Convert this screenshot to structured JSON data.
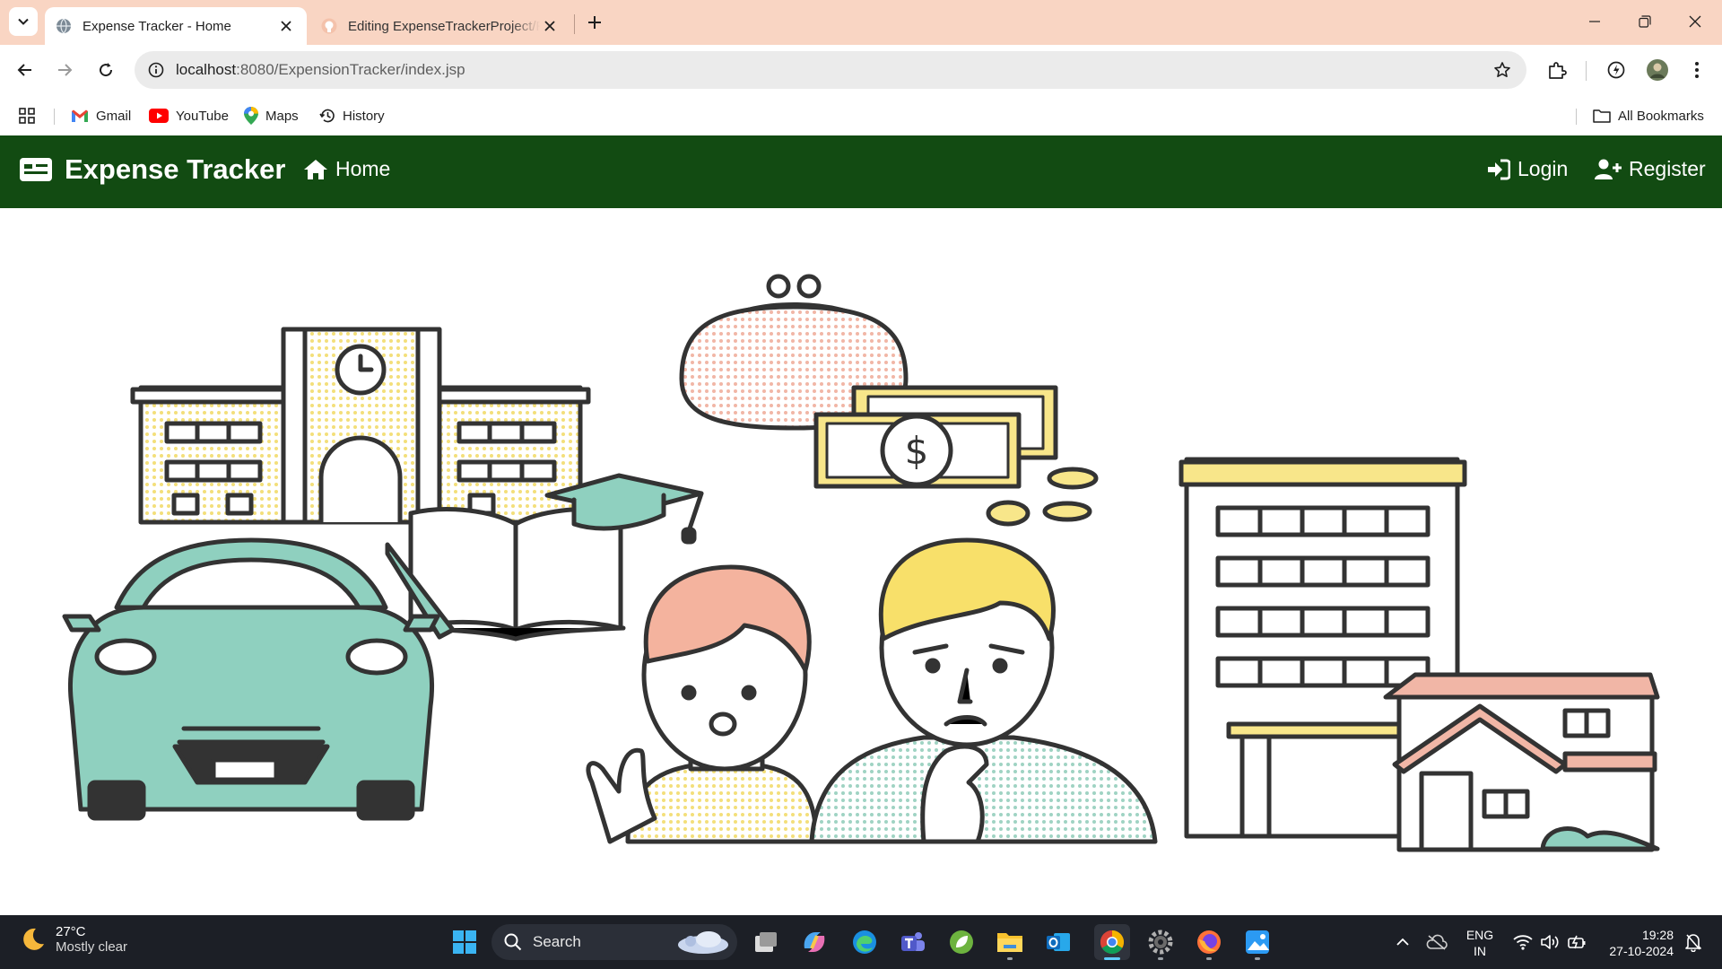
{
  "browser": {
    "tabs": [
      {
        "title": "Expense Tracker - Home",
        "active": true,
        "favicon": "globe-icon"
      },
      {
        "title": "Editing ExpenseTrackerProject/R",
        "active": false,
        "favicon": "github-icon"
      }
    ],
    "url_host": "localhost",
    "url_path": ":8080/ExpensionTracker/index.jsp",
    "bookmarks": [
      {
        "label": "Gmail",
        "icon": "gmail-icon"
      },
      {
        "label": "YouTube",
        "icon": "youtube-icon"
      },
      {
        "label": "Maps",
        "icon": "maps-icon"
      },
      {
        "label": "History",
        "icon": "history-icon"
      }
    ],
    "all_bookmarks_label": "All Bookmarks",
    "tab_strip_color": "#f9d5c3"
  },
  "app": {
    "brand": "Expense Tracker",
    "nav_home": "Home",
    "nav_login": "Login",
    "nav_register": "Register",
    "navbar_color": "#124b12"
  },
  "taskbar": {
    "weather_temp": "27°C",
    "weather_desc": "Mostly clear",
    "search_placeholder": "Search",
    "lang_top": "ENG",
    "lang_bottom": "IN",
    "time": "19:28",
    "date": "27-10-2024",
    "apps": [
      "windows-start-icon",
      "file-explorer-task-view-icon",
      "copilot-icon",
      "edge-icon",
      "teams-icon",
      "spring-tool-icon",
      "folder-icon",
      "outlook-icon",
      "chrome-icon",
      "settings-icon",
      "firefox-icon",
      "photos-icon"
    ]
  }
}
